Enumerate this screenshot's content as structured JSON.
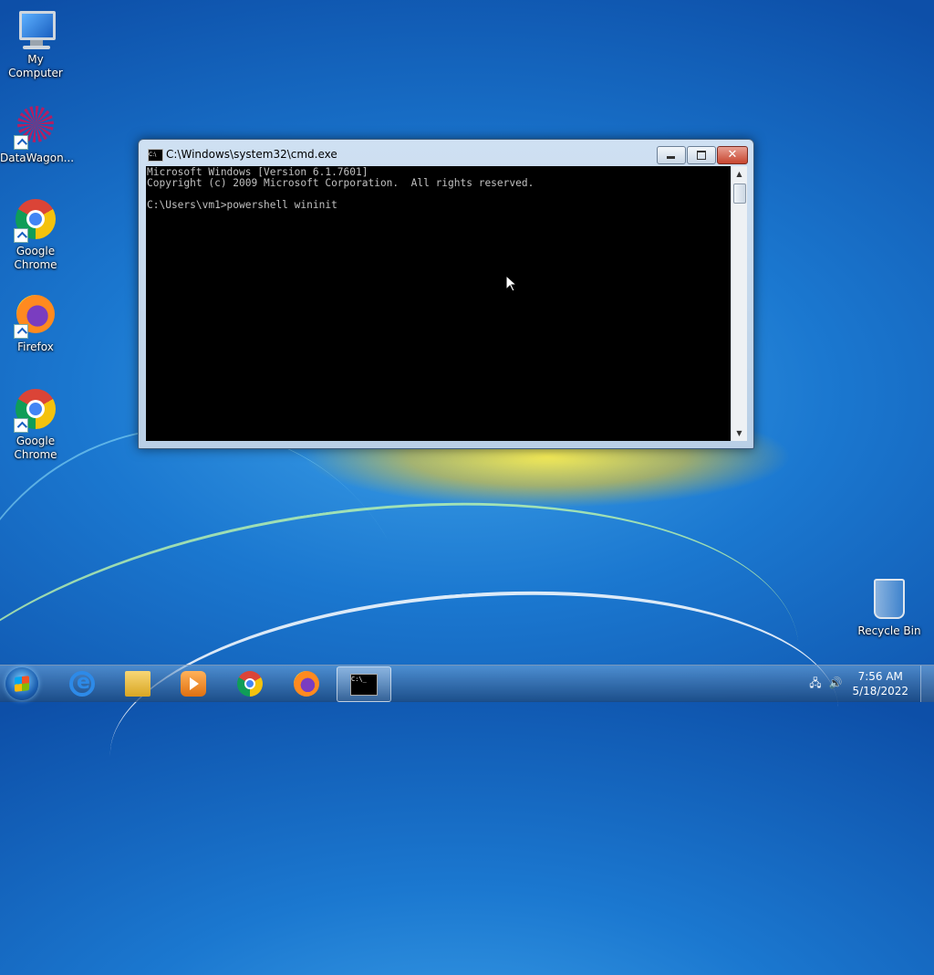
{
  "desktop": {
    "icons": [
      {
        "label": "My Computer"
      },
      {
        "label": "DataWagon..."
      },
      {
        "label": "Google Chrome"
      },
      {
        "label": "Firefox"
      },
      {
        "label": "Google Chrome"
      },
      {
        "label": "Recycle Bin"
      }
    ]
  },
  "cmd_window": {
    "title": "C:\\Windows\\system32\\cmd.exe",
    "icon_text": "C:\\",
    "lines": [
      "Microsoft Windows [Version 6.1.7601]",
      "Copyright (c) 2009 Microsoft Corporation.  All rights reserved.",
      "",
      "C:\\Users\\vm1>powershell wininit"
    ],
    "minimize_icon": "minimize-icon",
    "maximize_icon": "maximize-icon",
    "close_glyph": "✕"
  },
  "taskbar": {
    "cmd_icon_text": "C:\\_",
    "clock": {
      "time": "7:56 AM",
      "date": "5/18/2022"
    }
  }
}
